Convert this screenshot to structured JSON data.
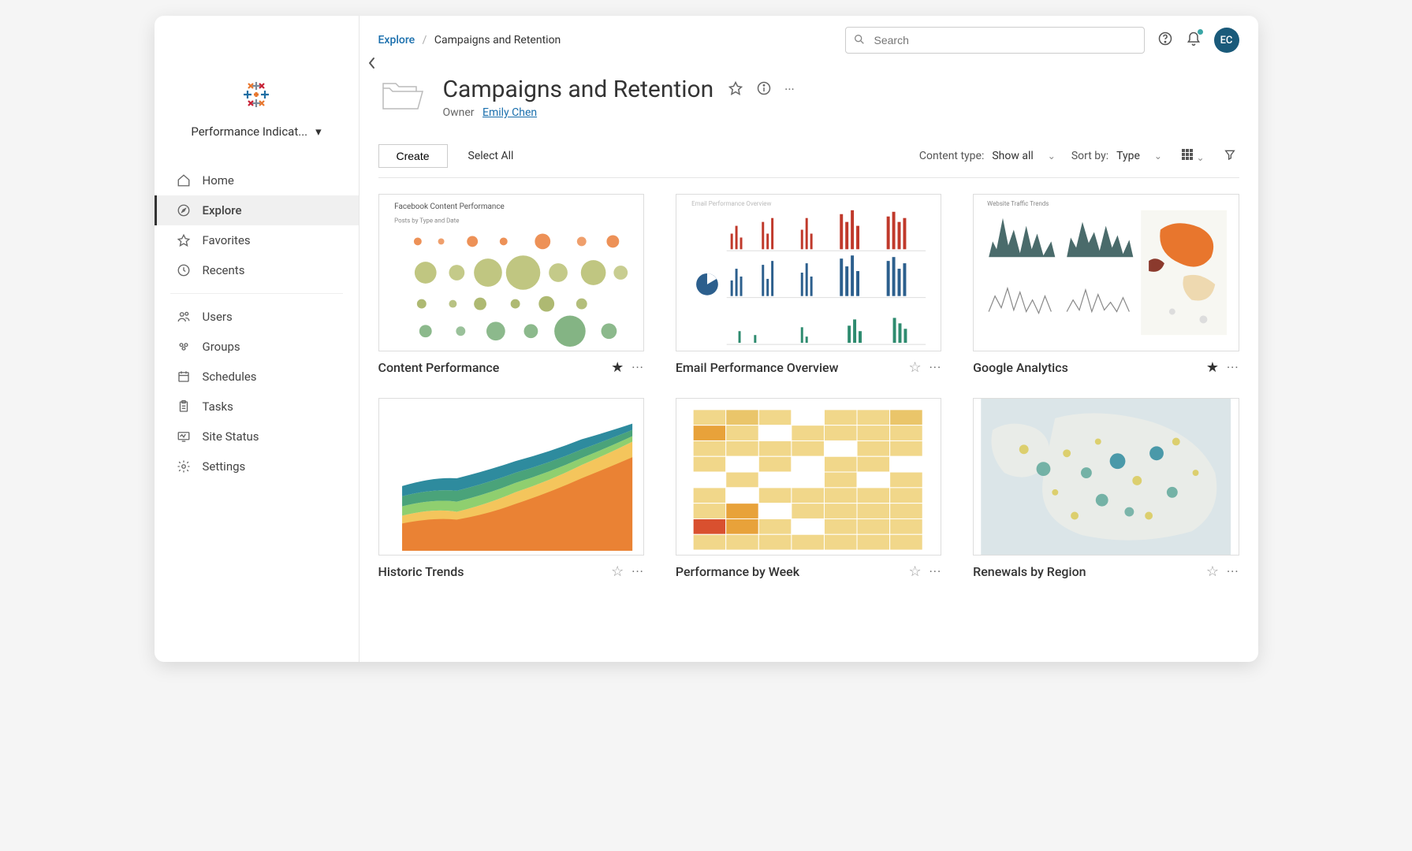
{
  "sidebar": {
    "site_selector": "Performance Indicat...",
    "nav": [
      {
        "icon": "home",
        "label": "Home",
        "active": false
      },
      {
        "icon": "compass",
        "label": "Explore",
        "active": true
      },
      {
        "icon": "star",
        "label": "Favorites",
        "active": false
      },
      {
        "icon": "clock",
        "label": "Recents",
        "active": false
      }
    ],
    "admin": [
      {
        "icon": "users",
        "label": "Users"
      },
      {
        "icon": "groups",
        "label": "Groups"
      },
      {
        "icon": "calendar",
        "label": "Schedules"
      },
      {
        "icon": "clipboard",
        "label": "Tasks"
      },
      {
        "icon": "monitor",
        "label": "Site Status"
      },
      {
        "icon": "gear",
        "label": "Settings"
      }
    ]
  },
  "breadcrumb": {
    "root": "Explore",
    "current": "Campaigns and Retention"
  },
  "search": {
    "placeholder": "Search"
  },
  "avatar": "EC",
  "page": {
    "title": "Campaigns and Retention",
    "owner_label": "Owner",
    "owner_name": "Emily Chen"
  },
  "toolbar": {
    "create": "Create",
    "select_all": "Select All",
    "content_type_label": "Content type:",
    "content_type_value": "Show all",
    "sort_by_label": "Sort by:",
    "sort_by_value": "Type"
  },
  "cards": [
    {
      "title": "Content Performance",
      "favorite": true,
      "thumb": "content"
    },
    {
      "title": "Email Performance Overview",
      "favorite": false,
      "thumb": "email"
    },
    {
      "title": "Google Analytics",
      "favorite": true,
      "thumb": "ga"
    },
    {
      "title": "Historic Trends",
      "favorite": false,
      "thumb": "trends"
    },
    {
      "title": "Performance by Week",
      "favorite": false,
      "thumb": "week"
    },
    {
      "title": "Renewals by Region",
      "favorite": false,
      "thumb": "region"
    }
  ]
}
